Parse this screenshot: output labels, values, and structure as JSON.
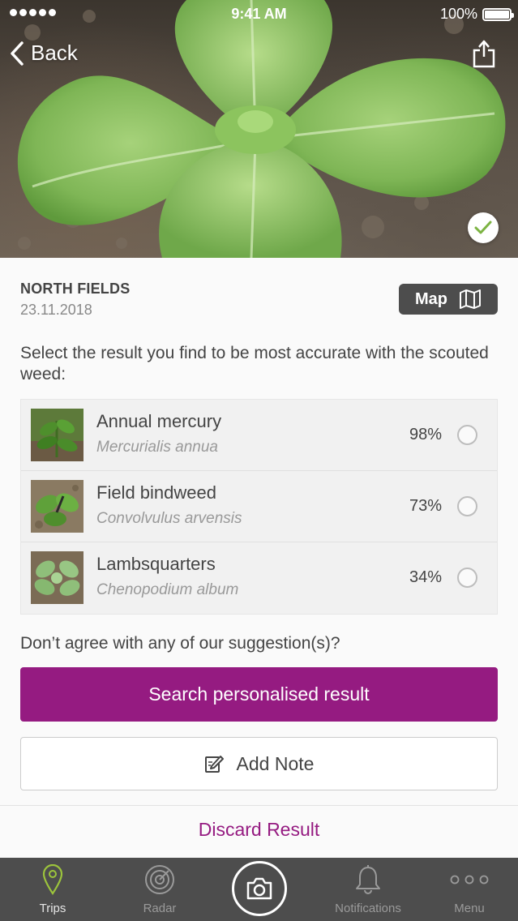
{
  "status_bar": {
    "time": "9:41 AM",
    "battery": "100%"
  },
  "header": {
    "back_label": "Back"
  },
  "field": {
    "name": "NORTH FIELDS",
    "date": "23.11.2018",
    "map_label": "Map"
  },
  "instruction": "Select the result you find to be most accurate with the scouted weed:",
  "results": [
    {
      "name": "Annual mercury",
      "latin": "Mercurialis annua",
      "percent": "98%"
    },
    {
      "name": "Field bindweed",
      "latin": "Convolvulus arvensis",
      "percent": "73%"
    },
    {
      "name": "Lambsquarters",
      "latin": "Chenopodium album",
      "percent": "34%"
    }
  ],
  "disagree_text": "Don’t agree with any of our suggestion(s)?",
  "actions": {
    "search_label": "Search personalised result",
    "note_label": "Add Note",
    "discard_label": "Discard Result"
  },
  "tabs": [
    {
      "label": "Trips",
      "icon": "map-pin-icon",
      "active": true
    },
    {
      "label": "Radar",
      "icon": "radar-icon",
      "active": false
    },
    {
      "label": "Notifications",
      "icon": "bell-icon",
      "active": false
    },
    {
      "label": "Menu",
      "icon": "more-dots-icon",
      "active": false
    }
  ],
  "colors": {
    "accent": "#951b81",
    "tabbar": "#4d4d4d",
    "active_tab_icon": "#9cc43c"
  }
}
